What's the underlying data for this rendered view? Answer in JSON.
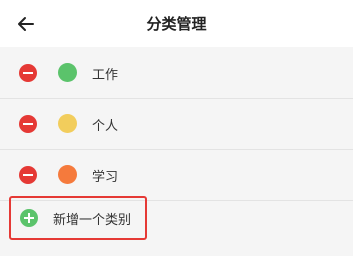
{
  "header": {
    "title": "分类管理"
  },
  "categories": [
    {
      "label": "工作",
      "color": "#5bc36b"
    },
    {
      "label": "个人",
      "color": "#f2cd5c"
    },
    {
      "label": "学习",
      "color": "#f57a3c"
    }
  ],
  "add_button": {
    "label": "新增一个类别"
  },
  "colors": {
    "delete": "#e53935",
    "add": "#5bc36b",
    "highlight_border": "#e53935"
  }
}
